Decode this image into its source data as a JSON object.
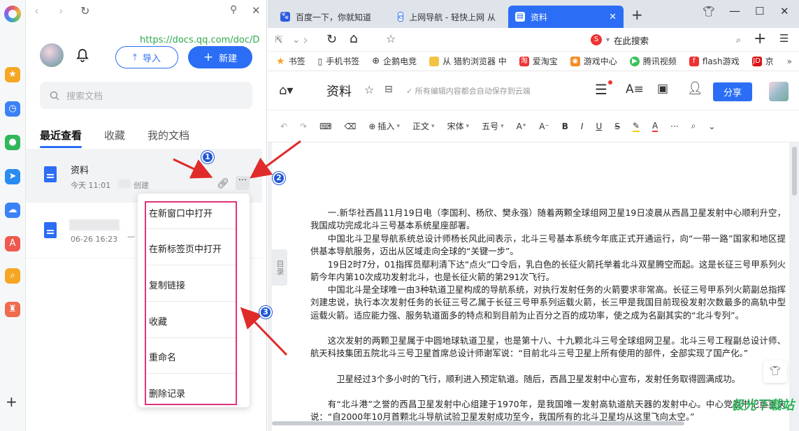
{
  "rail": {
    "icons": [
      "star-icon",
      "clock-icon",
      "wechat-icon",
      "share-icon",
      "cloud-icon",
      "pdf-icon",
      "search-icon",
      "app-icon"
    ]
  },
  "panel": {
    "import_label": "导入",
    "new_label": "新建",
    "search_placeholder": "搜索文档",
    "tabs": [
      "最近查看",
      "收藏",
      "我的文档"
    ],
    "files": [
      {
        "name": "资料",
        "meta": "今天 11:01",
        "meta_suffix": "创建"
      },
      {
        "name": "",
        "meta": "06-26 16:23",
        "meta_suffix": "—"
      }
    ],
    "menu": [
      "在新窗口中打开",
      "在新标签页中打开",
      "复制链接",
      "收藏",
      "重命名",
      "删除记录"
    ]
  },
  "badges": [
    "1",
    "2",
    "3"
  ],
  "browser": {
    "tabs": [
      {
        "title": "百度一下，你就知道",
        "icon": "baidu-icon"
      },
      {
        "title": "上网导航 - 轻快上网 从",
        "icon": "ie-icon"
      },
      {
        "title": "资料",
        "icon": "docs-icon"
      }
    ],
    "url": "https://docs.qq.com/doc/D",
    "search_placeholder": "在此搜索",
    "bookmarks": [
      "书签",
      "手机书签",
      "企鹅电竞",
      "从 猎豹浏览器 中",
      "爱淘宝",
      "游戏中心",
      "腾讯视频",
      "flash游戏",
      "京"
    ]
  },
  "doc": {
    "title": "资料",
    "save_status": "所有编辑内容都会自动保存到云端",
    "share_label": "分享",
    "toolbar": {
      "insert": "插入",
      "style": "正文",
      "font": "宋体",
      "size": "五号"
    },
    "toc_label": "目录",
    "paragraphs": [
      "一.新华社西昌11月19日电（李国利、杨欣、樊永强）随着两颗全球组网卫星19日凌晨从西昌卫星发射中心顺利升空，我国成功完成北斗三号基本系统星座部署。",
      "中国北斗卫星导航系统总设计师杨长风此间表示，北斗三号基本系统今年底正式开通运行，向“一带一路”国家和地区提供基本导航服务，迈出从区域走向全球的“关键一步”。",
      "19日2时7分，01指挥员鄢利清下达“点火”口令后，乳白色的长征火箭托举着北斗双星腾空而起。这是长征三号甲系列火箭今年内第10次成功发射北斗，也是长征火箭的第291次飞行。",
      "中国北斗是全球唯一由3种轨道卫星构成的导航系统，对执行发射任务的火箭要求非常高。长征三号甲系列火箭副总指挥刘建忠说，执行本次发射任务的长征三号乙属于长征三号甲系列运载火箭，长三甲是我国目前现役发射次数最多的高轨中型运载火箭。适应能力强、服务轨道面多的特点和到目前为止百分之百的成功率，使之成为名副其实的“北斗专列”。",
      "这次发射的两颗卫星属于中圆地球轨道卫星，也是第十八、十九颗北斗三号全球组网卫星。北斗三号工程副总设计师、航天科技集团五院北斗三号卫星首席总设计师谢军说：“目前北斗三号卫星上所有使用的部件，全部实现了国产化。”",
      "卫星经过3个多小时的飞行，顺利进入预定轨道。随后，西昌卫星发射中心宣布，发射任务取得圆满成功。",
      "有“北斗港”之誉的西昌卫星发射中心组建于1970年，是我国唯一发射高轨道航天器的发射中心。中心党委书记董重庆说：“自2000年10月首颗北斗导航试验卫星发射成功至今，我国所有的北斗卫星均从这里飞向太空。”"
    ]
  },
  "watermark": "极光下载站",
  "colors": {
    "accent": "#2b6ef5",
    "highlight": "#e0347a",
    "arrow": "#e02b2b",
    "badge": "#1f57d6"
  }
}
